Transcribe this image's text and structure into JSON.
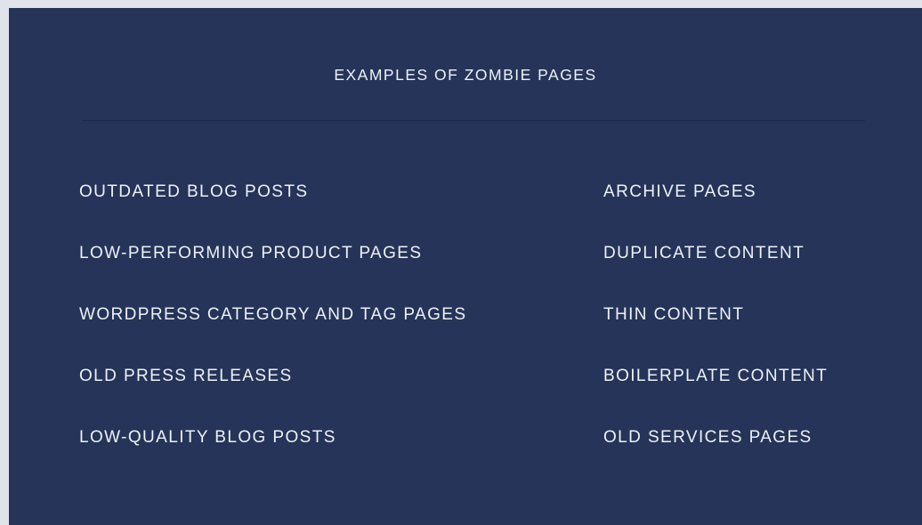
{
  "title": "EXAMPLES OF ZOMBIE PAGES",
  "left_items": [
    "OUTDATED BLOG POSTS",
    "LOW-PERFORMING PRODUCT PAGES",
    "WORDPRESS CATEGORY AND TAG PAGES",
    "OLD PRESS RELEASES",
    "LOW-QUALITY BLOG POSTS"
  ],
  "right_items": [
    "ARCHIVE PAGES",
    "DUPLICATE CONTENT",
    "THIN CONTENT",
    "BOILERPLATE CONTENT",
    "OLD SERVICES PAGES"
  ],
  "colors": {
    "panel_background": "#253458",
    "page_background": "#dfe3ea",
    "text": "#eef1f7",
    "divider": "#1b2846"
  }
}
